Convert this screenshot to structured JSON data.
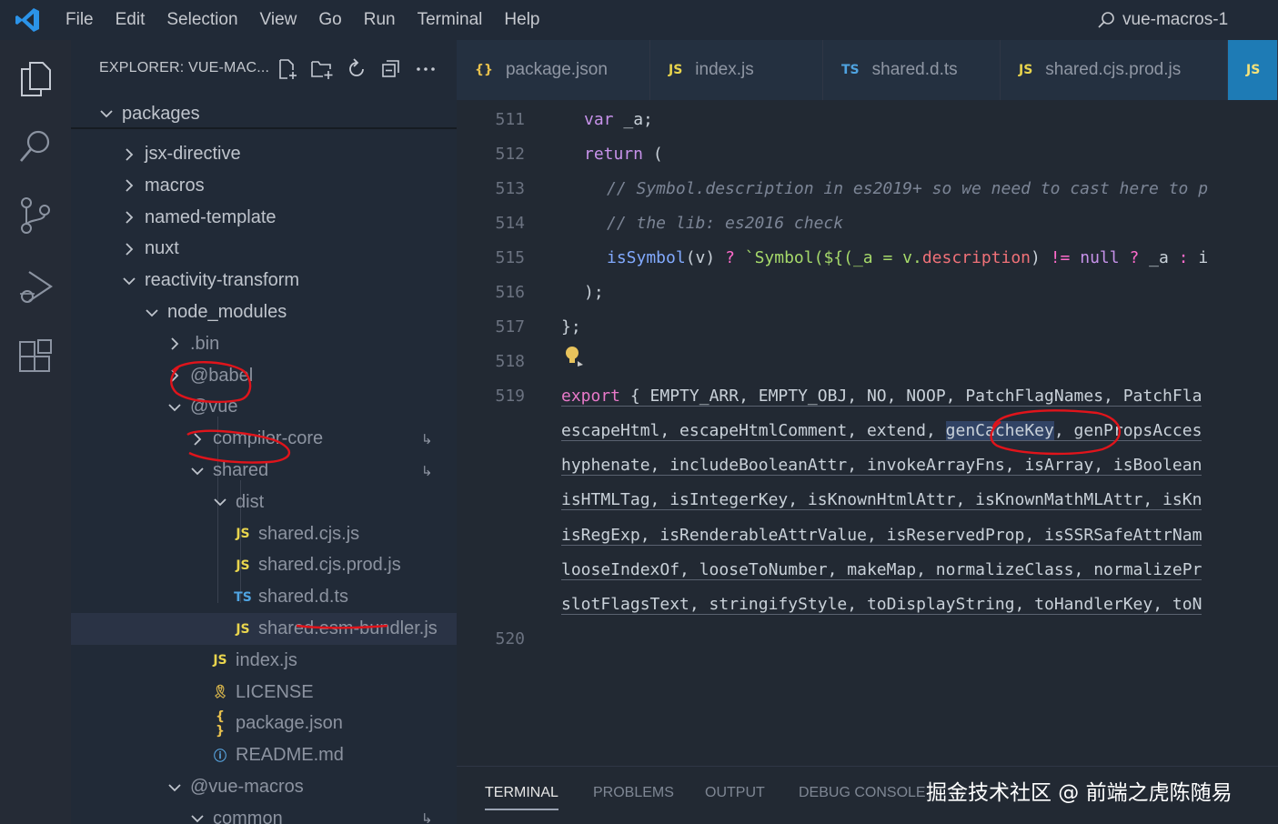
{
  "titlebar": {
    "menu": [
      "File",
      "Edit",
      "Selection",
      "View",
      "Go",
      "Run",
      "Terminal",
      "Help"
    ],
    "search_text": "vue-macros-1"
  },
  "sidebar": {
    "title": "EXPLORER: VUE-MAC...",
    "sticky": "packages",
    "tree": [
      {
        "label": "jsx-directive",
        "type": "folder",
        "open": false
      },
      {
        "label": "macros",
        "type": "folder",
        "open": false
      },
      {
        "label": "named-template",
        "type": "folder",
        "open": false
      },
      {
        "label": "nuxt",
        "type": "folder",
        "open": false
      },
      {
        "label": "reactivity-transform",
        "type": "folder",
        "open": true
      },
      {
        "label": "node_modules",
        "type": "folder",
        "open": true
      },
      {
        "label": ".bin",
        "type": "folder",
        "open": false
      },
      {
        "label": "@babel",
        "type": "folder",
        "open": false
      },
      {
        "label": "@vue",
        "type": "folder",
        "open": true
      },
      {
        "label": "compiler-core",
        "type": "folder",
        "open": false,
        "link": "↳"
      },
      {
        "label": "shared",
        "type": "folder",
        "open": true,
        "link": "↳"
      },
      {
        "label": "dist",
        "type": "folder",
        "open": true
      },
      {
        "label": "shared.cjs.js",
        "type": "js"
      },
      {
        "label": "shared.cjs.prod.js",
        "type": "js"
      },
      {
        "label": "shared.d.ts",
        "type": "ts"
      },
      {
        "label": "shared.esm-bundler.js",
        "type": "js",
        "selected": true
      },
      {
        "label": "index.js",
        "type": "js"
      },
      {
        "label": "LICENSE",
        "type": "license"
      },
      {
        "label": "package.json",
        "type": "json"
      },
      {
        "label": "README.md",
        "type": "info"
      },
      {
        "label": "@vue-macros",
        "type": "folder",
        "open": true
      },
      {
        "label": "common",
        "type": "folder",
        "open": true,
        "link": "↳"
      }
    ]
  },
  "tabs": [
    {
      "icon": "{}",
      "label": "package.json"
    },
    {
      "icon": "JS",
      "label": "index.js"
    },
    {
      "icon": "TS",
      "label": "shared.d.ts"
    },
    {
      "icon": "JS",
      "label": "shared.cjs.prod.js"
    },
    {
      "icon": "JS",
      "label": ""
    }
  ],
  "editor": {
    "line_numbers": [
      "511",
      "512",
      "513",
      "514",
      "515",
      "516",
      "517",
      "518",
      "519",
      "520"
    ],
    "code": {
      "l511_kw": "var",
      "l511_rest": " _a;",
      "l512_kw": "return",
      "l512_rest": " (",
      "l513": "// Symbol.description in es2019+ so we need to cast here to p",
      "l514": "// the lib: es2016 check",
      "l515_fn": "isSymbol",
      "l515_a": "(v) ",
      "l515_q": "?",
      "l515_b": " `Symbol(${(_a = v.",
      "l515_prop": "description",
      "l515_c": ") ",
      "l515_ne": "!=",
      "l515_sp": " ",
      "l515_null": "null",
      "l515_d": " ",
      "l515_q2": "?",
      "l515_e": " _a ",
      "l515_col": ":",
      "l515_f": " i",
      "l516": ");",
      "l517": "};",
      "l519_kw": "export",
      "l519_rest": " { EMPTY_ARR, EMPTY_OBJ, NO, NOOP, PatchFlagNames, PatchFla",
      "w1_a": "escapeHtml, escapeHtmlComment, extend, ",
      "w1_hl": "genCacheKey",
      "w1_b": ", genPropsAcces",
      "w2": "hyphenate, includeBooleanAttr, invokeArrayFns, isArray, isBoolean",
      "w3": "isHTMLTag, isIntegerKey, isKnownHtmlAttr, isKnownMathMLAttr, isKn",
      "w4": "isRegExp, isRenderableAttrValue, isReservedProp, isSSRSafeAttrNam",
      "w5": "looseIndexOf, looseToNumber, makeMap, normalizeClass, normalizePr",
      "w6": "slotFlagsText, stringifyStyle, toDisplayString, toHandlerKey, toN"
    }
  },
  "panel": {
    "tabs": [
      "TERMINAL",
      "PROBLEMS",
      "OUTPUT",
      "DEBUG CONSOLE"
    ]
  },
  "watermark": "掘金技术社区 @ 前端之虎陈随易",
  "colors": {
    "accent_tab": "#1e7bb5",
    "annotation_red": "#e0141b"
  }
}
